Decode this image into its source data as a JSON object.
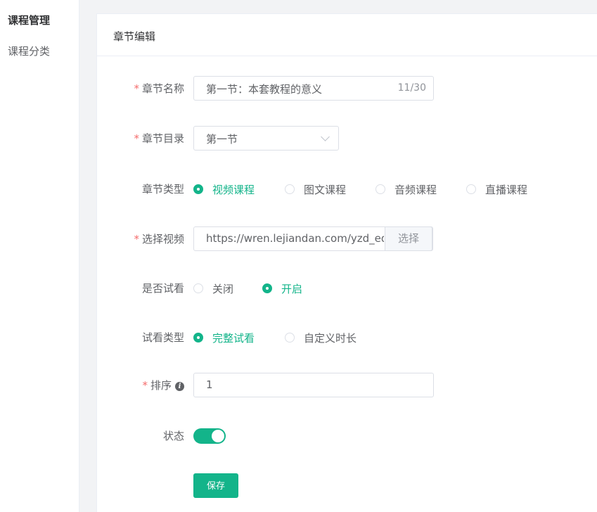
{
  "sidebar": {
    "items": [
      {
        "label": "课程管理"
      },
      {
        "label": "课程分类"
      }
    ]
  },
  "card": {
    "title": "章节编辑"
  },
  "form": {
    "chapter_name": {
      "label": "章节名称",
      "required": "*",
      "value": "第一节：本套教程的意义",
      "counter": "11/30"
    },
    "chapter_dir": {
      "label": "章节目录",
      "required": "*",
      "value": "第一节"
    },
    "chapter_type": {
      "label": "章节类型",
      "options": [
        "视频课程",
        "图文课程",
        "音频课程",
        "直播课程"
      ],
      "selected": "视频课程"
    },
    "video": {
      "label": "选择视频",
      "required": "*",
      "value": "https://wren.lejiandan.com/yzd_ed",
      "button": "选择"
    },
    "trial": {
      "label": "是否试看",
      "options": [
        "关闭",
        "开启"
      ],
      "selected": "开启"
    },
    "trial_type": {
      "label": "试看类型",
      "options": [
        "完整试看",
        "自定义时长"
      ],
      "selected": "完整试看"
    },
    "sort": {
      "label": "排序",
      "required": "*",
      "info_icon": "i",
      "value": "1"
    },
    "status": {
      "label": "状态",
      "on": true
    },
    "save_label": "保存"
  },
  "colors": {
    "accent": "#13b48a",
    "required": "#f56c6c"
  }
}
